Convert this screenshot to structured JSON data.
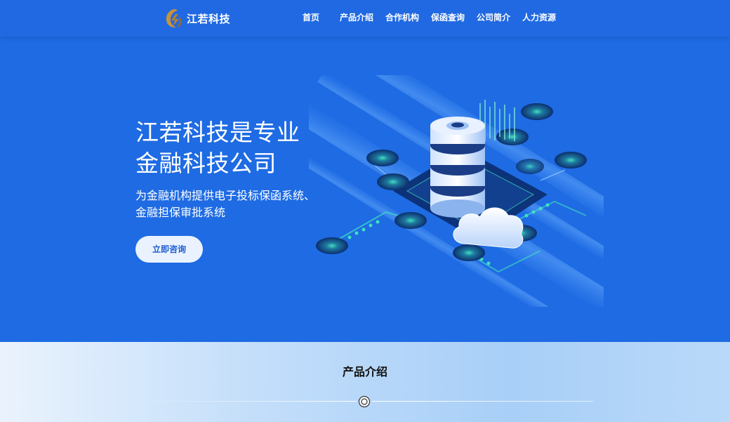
{
  "brand": {
    "name": "江若科技"
  },
  "nav": [
    {
      "label": "首页"
    },
    {
      "label": "产品介绍"
    },
    {
      "label": "合作机构"
    },
    {
      "label": "保函查询"
    },
    {
      "label": "公司简介"
    },
    {
      "label": "人力资源"
    }
  ],
  "hero": {
    "title_line1": "江若科技是专业",
    "title_line2": "金融科技公司",
    "subtitle": "为金融机构提供电子投标保函系统、金融担保审批系统",
    "cta_label": "立即咨询"
  },
  "products": {
    "title": "产品介绍"
  },
  "colors": {
    "primary": "#1e6be3",
    "header": "#2069e2",
    "accent_gold": "#c9923a"
  },
  "icons": {
    "logo": "brand-logo-icon",
    "divider": "ring-icon"
  }
}
